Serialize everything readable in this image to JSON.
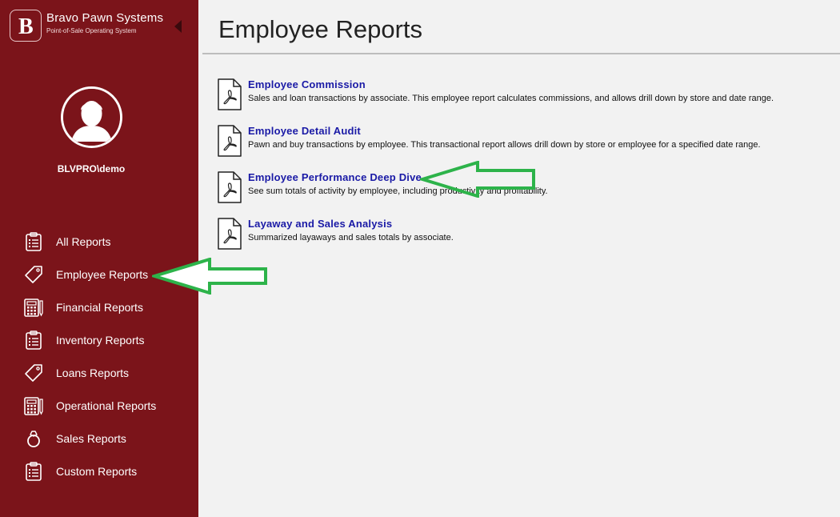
{
  "brand": {
    "title": "Bravo Pawn Systems",
    "subtitle": "Point-of-Sale Operating System",
    "logo_letter": "B"
  },
  "user": {
    "name": "BLVPRO\\demo"
  },
  "sidebar": {
    "items": [
      {
        "label": "All Reports",
        "icon": "clipboard-icon"
      },
      {
        "label": "Employee Reports",
        "icon": "tag-icon"
      },
      {
        "label": "Financial Reports",
        "icon": "calculator-icon"
      },
      {
        "label": "Inventory Reports",
        "icon": "clipboard-icon"
      },
      {
        "label": "Loans Reports",
        "icon": "tag-icon"
      },
      {
        "label": "Operational Reports",
        "icon": "calculator-icon"
      },
      {
        "label": "Sales Reports",
        "icon": "ring-icon"
      },
      {
        "label": "Custom Reports",
        "icon": "clipboard-icon"
      }
    ]
  },
  "main": {
    "title": "Employee Reports",
    "reports": [
      {
        "title": "Employee Commission",
        "description": "Sales and loan transactions by associate. This employee report calculates commissions, and allows drill down by store and date range."
      },
      {
        "title": "Employee Detail Audit",
        "description": "Pawn and buy transactions by employee. This transactional report allows drill down by store or employee for a specified date range."
      },
      {
        "title": "Employee Performance Deep Dive",
        "description": "See sum totals of activity by employee, including productivity and profitability."
      },
      {
        "title": "Layaway and Sales Analysis",
        "description": "Summarized layaways and sales totals by associate."
      }
    ]
  },
  "colors": {
    "sidebar_bg": "#7b141a",
    "link": "#1a1aa6",
    "annotation_arrow": "#2db34a"
  }
}
